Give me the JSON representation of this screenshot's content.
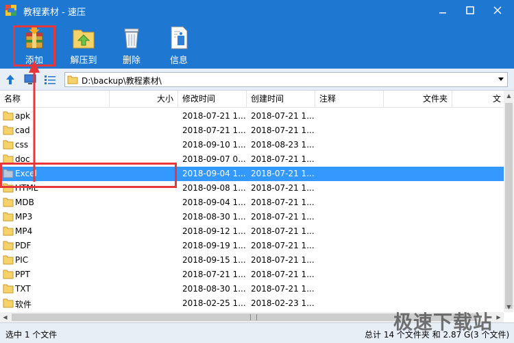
{
  "window": {
    "title": "教程素材 - 速压",
    "accent": "#1e78d2",
    "highlight_color": "#e8373b",
    "selection_color": "#3399ff"
  },
  "toolbar": {
    "add_label": "添加",
    "extract_label": "解压到",
    "delete_label": "删除",
    "info_label": "信息"
  },
  "address": {
    "path": "D:\\backup\\教程素材\\"
  },
  "columns": {
    "name": "名称",
    "size": "大小",
    "modified": "修改时间",
    "created": "创建时间",
    "comment": "注释",
    "folder": "文件夹",
    "extra": "文"
  },
  "files": [
    {
      "name": "apk",
      "modified": "2018-07-21 1...",
      "created": "2018-07-21 1..."
    },
    {
      "name": "cad",
      "modified": "2018-07-21 1...",
      "created": "2018-07-21 1..."
    },
    {
      "name": "css",
      "modified": "2018-09-10 1...",
      "created": "2018-08-23 1..."
    },
    {
      "name": "doc",
      "modified": "2018-09-07 0...",
      "created": "2018-07-21 1..."
    },
    {
      "name": "Excel",
      "modified": "2018-09-04 1...",
      "created": "2018-07-21 1...",
      "selected": true
    },
    {
      "name": "HTML",
      "modified": "2018-09-08 1...",
      "created": "2018-07-21 1..."
    },
    {
      "name": "MDB",
      "modified": "2018-09-04 1...",
      "created": "2018-07-21 1..."
    },
    {
      "name": "MP3",
      "modified": "2018-08-30 1...",
      "created": "2018-07-21 1..."
    },
    {
      "name": "MP4",
      "modified": "2018-09-12 1...",
      "created": "2018-07-21 1..."
    },
    {
      "name": "PDF",
      "modified": "2018-09-19 1...",
      "created": "2018-07-21 1..."
    },
    {
      "name": "PIC",
      "modified": "2018-09-15 1...",
      "created": "2018-07-21 1..."
    },
    {
      "name": "PPT",
      "modified": "2018-07-21 1...",
      "created": "2018-07-21 1..."
    },
    {
      "name": "TXT",
      "modified": "2018-08-30 1...",
      "created": "2018-07-21 1..."
    },
    {
      "name": "软件",
      "modified": "2018-02-25 1...",
      "created": "2018-02-23 1..."
    }
  ],
  "status": {
    "left": "选中 1 个文件",
    "right": "总计 14 个文件夹 和 2.87 G(3 个文件)"
  },
  "watermark": "极速下载站"
}
